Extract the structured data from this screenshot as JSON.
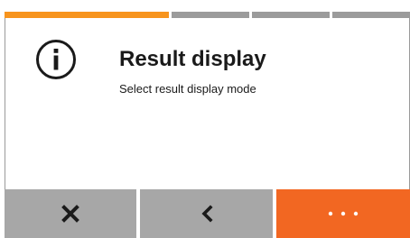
{
  "progress": {
    "segments": [
      {
        "state": "active",
        "color": "#f7941d"
      },
      {
        "state": "inactive",
        "color": "#9b9b9b"
      },
      {
        "state": "inactive",
        "color": "#9b9b9b"
      },
      {
        "state": "inactive",
        "color": "#9b9b9b"
      }
    ],
    "current_step": 1,
    "total_steps": 4
  },
  "content": {
    "icon": "info-icon",
    "title": "Result display",
    "subtitle": "Select result display mode"
  },
  "bottom_bar": {
    "cancel_icon": "close-icon",
    "back_icon": "chevron-left-icon",
    "more_icon": "more-dots-icon"
  },
  "colors": {
    "accent": "#f26722",
    "button_gray": "#a7a7a7",
    "progress_active": "#f7941d",
    "progress_inactive": "#9b9b9b"
  }
}
